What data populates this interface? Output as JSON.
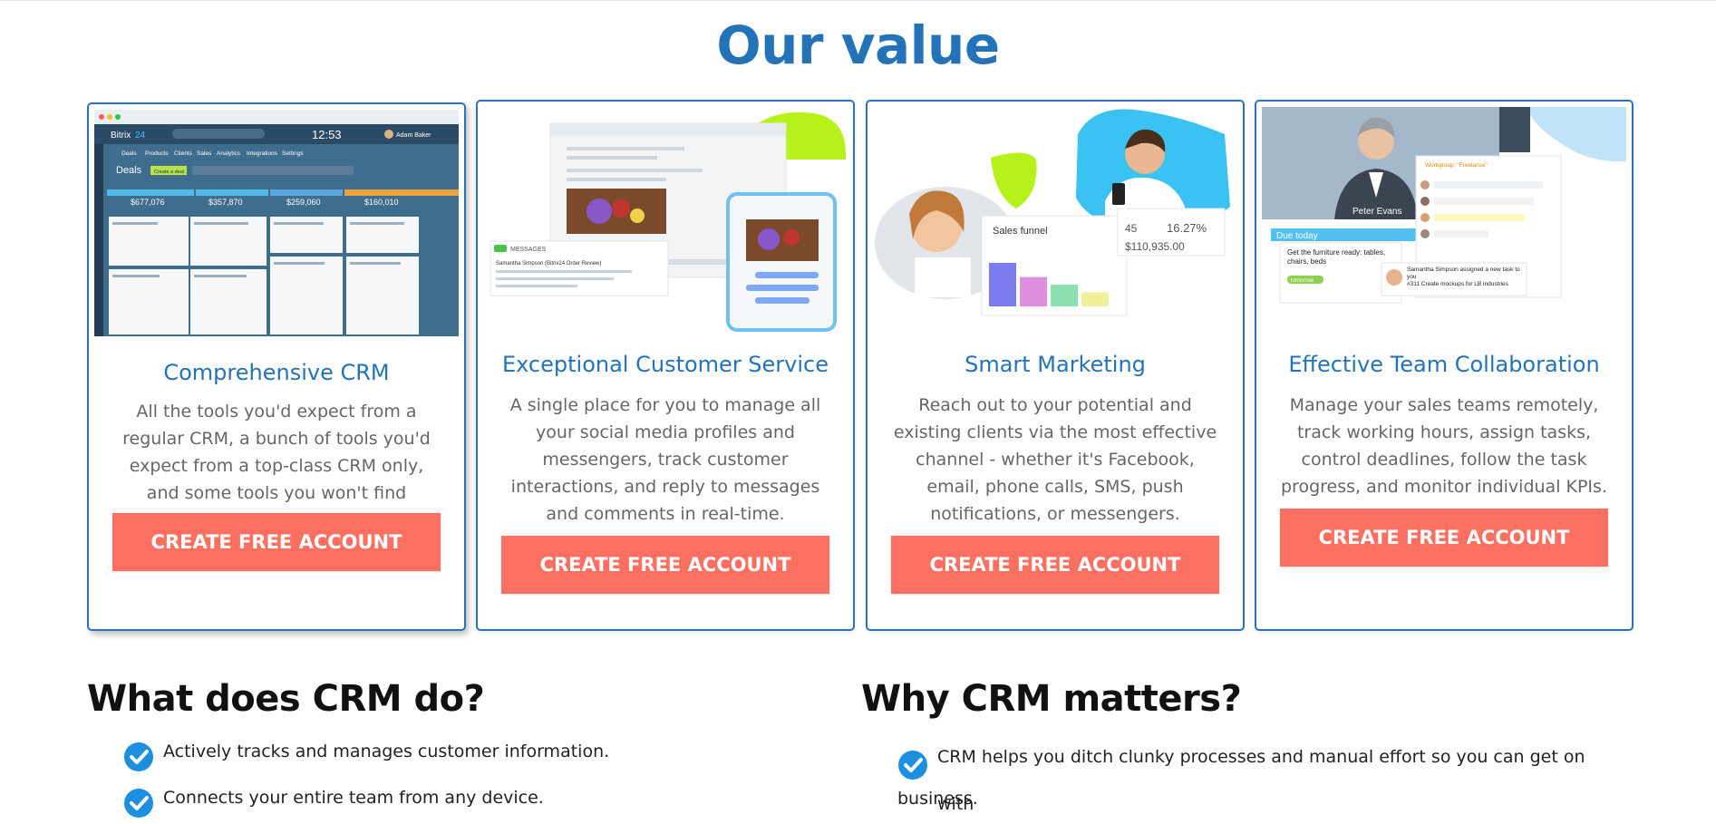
{
  "section_title": "Our value",
  "cards": [
    {
      "title": "Comprehensive CRM",
      "text": "All the tools you'd expect from a regular CRM, a bunch of tools you'd expect from a top-class CRM only, and some tools you won't find anywhere.",
      "cta": "CREATE FREE ACCOUNT",
      "image": {
        "app_name": "Bitrix",
        "app_number": "24",
        "time": "12:53",
        "user": "Adam Baker",
        "tabs": [
          "Deals",
          "Products",
          "Clients",
          "Sales",
          "Analytics",
          "Integrations",
          "Settings"
        ],
        "heading": "Deals",
        "create_button": "Create a deal",
        "columns": [
          "$677,076",
          "$357,870",
          "$259,060",
          "$160,010"
        ]
      }
    },
    {
      "title": "Exceptional Customer Service",
      "text": "A single place for you to manage all your social media profiles and messengers, track customer interactions, and reply to messages and comments in real-time.",
      "cta": "CREATE FREE ACCOUNT",
      "image": {
        "messages_label": "MESSAGES",
        "sender": "Samantha Simpson (Bitrix24 Order Review)"
      }
    },
    {
      "title": "Smart Marketing",
      "text": "Reach out to your potential and existing clients via the most effective channel - whether it's Facebook, email, phone calls, SMS, push notifications, or messengers.",
      "cta": "CREATE FREE ACCOUNT",
      "image": {
        "funnel_label": "Sales funnel",
        "stat_count": "45",
        "stat_percent": "16.27%",
        "stat_amount": "$110,935.00",
        "bar_values": [
          40,
          27,
          20,
          13
        ],
        "bar_colors": [
          "#7b7cf0",
          "#e08ee0",
          "#8fe0b0",
          "#f0f09a"
        ]
      }
    },
    {
      "title": "Effective Team Collaboration",
      "text": "Manage your sales teams remotely, track working hours, assign tasks, control deadlines, follow the task progress, and monitor individual KPIs.",
      "cta": "CREATE FREE ACCOUNT",
      "image": {
        "caller_name": "Peter Evans",
        "due_label": "Due today",
        "task_text": "Get the furniture ready: tables, chairs, beds",
        "task_badge": "tomorrow",
        "workgroup": "Workgroup: \"Freelance\"",
        "notif_text": "Samantha Simpson assigned a new task to you",
        "notif_task": "#311 Create mockups for LB industries"
      }
    }
  ],
  "what_crm_does": {
    "title": "What does CRM do?",
    "items": [
      "Actively tracks and manages customer information.",
      "Connects your entire team from any device."
    ]
  },
  "why_crm_matters": {
    "title": "Why CRM matters?",
    "item_line1": "CRM helps you ditch clunky processes and manual effort so you can get on with",
    "item_line2": "business."
  },
  "colors": {
    "accent": "#2473b8",
    "card_border": "#2a72c0",
    "cta": "#fb7061",
    "check": "#1d8fe1"
  }
}
